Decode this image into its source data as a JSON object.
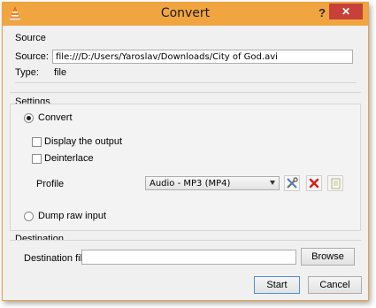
{
  "window": {
    "title": "Convert",
    "help_label": "?",
    "close_label": "✕"
  },
  "source": {
    "group_title": "Source",
    "source_label": "Source:",
    "source_value": "file:///D:/Users/Yaroslav/Downloads/City of God.avi",
    "type_label": "Type:",
    "type_value": "file"
  },
  "settings": {
    "group_title": "Settings",
    "convert_label": "Convert",
    "convert_selected": true,
    "display_output_label": "Display the output",
    "display_output_checked": false,
    "deinterlace_label": "Deinterlace",
    "deinterlace_checked": false,
    "profile_label": "Profile",
    "profile_value": "Audio - MP3 (MP4)",
    "dump_raw_label": "Dump raw input",
    "dump_raw_selected": false
  },
  "destination": {
    "group_title": "Destination",
    "file_label": "Destination file:",
    "file_value": "",
    "browse_label": "Browse"
  },
  "actions": {
    "start_label": "Start",
    "cancel_label": "Cancel"
  }
}
